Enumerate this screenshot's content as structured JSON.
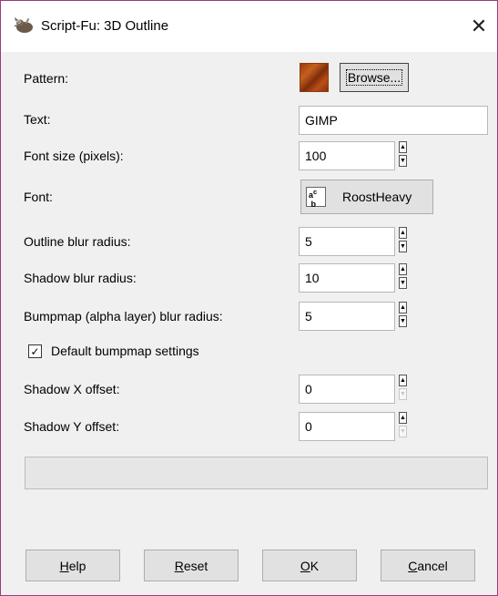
{
  "window": {
    "title": "Script-Fu: 3D Outline",
    "close_glyph": "✕",
    "accent_border": "#9a3a7e"
  },
  "pattern": {
    "label": "Pattern:",
    "browse_label": "Browse..."
  },
  "text": {
    "label": "Text:",
    "value": "GIMP"
  },
  "font_size": {
    "label": "Font size (pixels):",
    "value": "100"
  },
  "font": {
    "label": "Font:",
    "value": "RoostHeavy",
    "icon": "font-icon"
  },
  "outline_blur": {
    "label": "Outline blur radius:",
    "value": "5"
  },
  "shadow_blur": {
    "label": "Shadow blur radius:",
    "value": "10"
  },
  "bumpmap_blur": {
    "label": "Bumpmap (alpha layer) blur radius:",
    "value": "5"
  },
  "default_bumpmap": {
    "label": "Default bumpmap settings",
    "checked": true
  },
  "shadow_x": {
    "label": "Shadow X offset:",
    "value": "0"
  },
  "shadow_y": {
    "label": "Shadow Y offset:",
    "value": "0"
  },
  "progress": {
    "value": 0
  },
  "buttons": {
    "help": {
      "mnemonic": "H",
      "rest": "elp"
    },
    "reset": {
      "mnemonic": "R",
      "rest": "eset"
    },
    "ok": {
      "mnemonic": "O",
      "rest": "K"
    },
    "cancel": {
      "mnemonic": "C",
      "rest": "ancel"
    }
  }
}
